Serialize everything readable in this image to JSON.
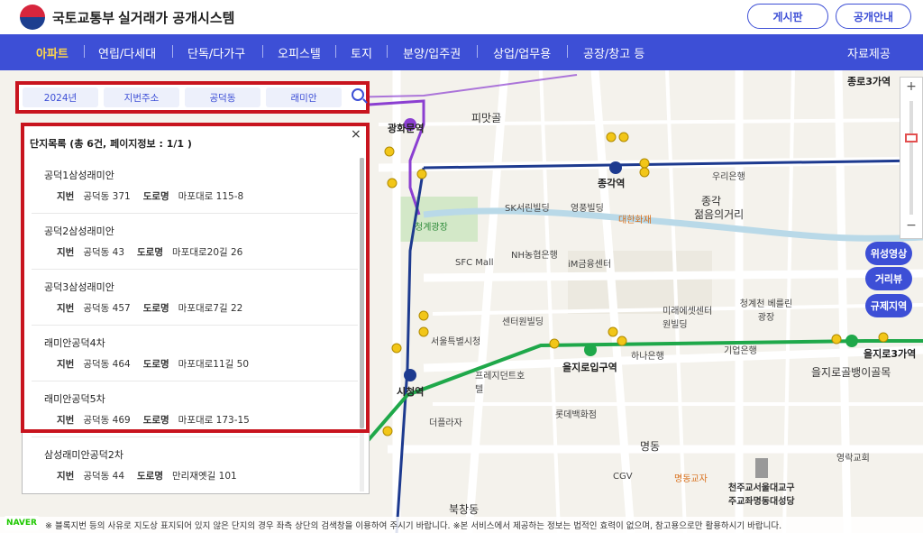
{
  "header": {
    "ministry": "국토교통부",
    "system_title": "실거래가 공개시스템",
    "board_label": "게시판",
    "guide_label": "공개안내"
  },
  "nav": {
    "items": [
      {
        "label": "아파트",
        "active": true
      },
      {
        "label": "연립/다세대"
      },
      {
        "label": "단독/다가구"
      },
      {
        "label": "오피스텔"
      },
      {
        "label": "토지"
      },
      {
        "label": "분양/입주권"
      },
      {
        "label": "상업/업무용"
      },
      {
        "label": "공장/창고 등"
      }
    ],
    "right_label": "자료제공"
  },
  "search": {
    "year": "2024년",
    "address_type": "지번주소",
    "dong": "공덕동",
    "keyword": "래미안"
  },
  "results": {
    "title": "단지목록 (총 6건, 페이지정보 : 1/1 )",
    "close_label": "×",
    "jibun_label": "지번",
    "road_label": "도로명",
    "items": [
      {
        "name": "공덕1삼성래미안",
        "jibun": "공덕동 371",
        "road": "마포대로 115-8"
      },
      {
        "name": "공덕2삼성래미안",
        "jibun": "공덕동 43",
        "road": "마포대로20길 26"
      },
      {
        "name": "공덕3삼성래미안",
        "jibun": "공덕동 457",
        "road": "마포대로7길 22"
      },
      {
        "name": "래미안공덕4차",
        "jibun": "공덕동 464",
        "road": "마포대로11길 50"
      },
      {
        "name": "래미안공덕5차",
        "jibun": "공덕동 469",
        "road": "마포대로 173-15"
      },
      {
        "name": "삼성래미안공덕2차",
        "jibun": "공덕동 44",
        "road": "만리재옛길 101"
      }
    ]
  },
  "map": {
    "zoom_in": "+",
    "zoom_out": "−",
    "side_buttons": [
      "위성영상",
      "거리뷰",
      "규제지역"
    ],
    "labels": [
      {
        "text": "피맛골"
      },
      {
        "text": "종각역"
      },
      {
        "text": "종각"
      },
      {
        "text": "젊음의거리"
      },
      {
        "text": "광화문역"
      },
      {
        "text": "시청역"
      },
      {
        "text": "을지로입구역"
      },
      {
        "text": "을지로3가역"
      },
      {
        "text": "을지로골뱅이골목"
      },
      {
        "text": "종로3가역"
      },
      {
        "text": "청계광장"
      },
      {
        "text": "SFC Mall"
      },
      {
        "text": "NH농협은행"
      },
      {
        "text": "iM금융센터"
      },
      {
        "text": "서울특별시청"
      },
      {
        "text": "명동"
      },
      {
        "text": "우리은행"
      },
      {
        "text": "기업은행"
      },
      {
        "text": "하나은행"
      },
      {
        "text": "영풍빌딩"
      },
      {
        "text": "대한화재"
      },
      {
        "text": "청계천 베를린광장"
      },
      {
        "text": "미래에셋센터원빌딩"
      },
      {
        "text": "롯데백화점"
      },
      {
        "text": "천주교서울대교구 주교좌명동대성당"
      },
      {
        "text": "영락교회"
      },
      {
        "text": "SK서린빌딩"
      },
      {
        "text": "센터원빌딩"
      },
      {
        "text": "프레지던트호텔"
      },
      {
        "text": "더플라자"
      },
      {
        "text": "CGV"
      },
      {
        "text": "명동교자"
      },
      {
        "text": "북창동"
      }
    ],
    "colors": {
      "line1": "#1d3a8f",
      "line2": "#1fa84a",
      "line5": "#8b3fd1",
      "road": "#ffffff",
      "stream": "#b9d9e8",
      "park": "#d3e8c8"
    }
  },
  "notice": "※ 블록지번 등의 사유로 지도상 표지되어 있지 않은 단지의 경우 좌측 상단의 검색창을 이용하여 주시기 바랍니다. ※본 서비스에서 제공하는 정보는 법적인 효력이 없으며, 참고용으로만 활용하시기 바랍니다.",
  "naver_logo": "NAVER"
}
